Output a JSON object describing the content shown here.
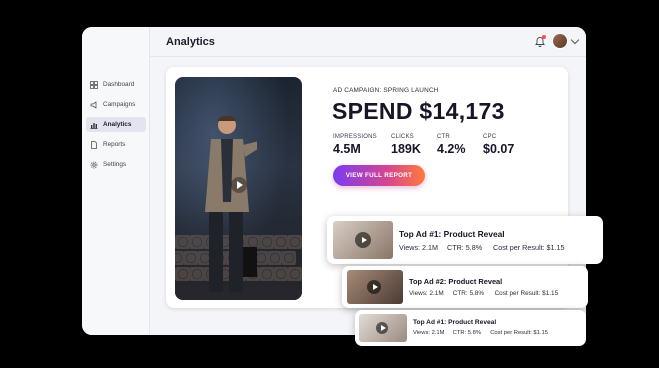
{
  "app": {
    "title": "Analytics"
  },
  "sidebar": {
    "items": [
      {
        "label": "Dashboard",
        "icon": "grid-icon"
      },
      {
        "label": "Campaigns",
        "icon": "megaphone-icon"
      },
      {
        "label": "Analytics",
        "icon": "chart-icon",
        "active": true
      },
      {
        "label": "Reports",
        "icon": "document-icon"
      },
      {
        "label": "Settings",
        "icon": "gear-icon"
      }
    ]
  },
  "campaign": {
    "label": "AD CAMPAIGN: SPRING LAUNCH",
    "spend": "SPEND $14,173",
    "metrics": [
      {
        "label": "IMPRESSIONS",
        "value": "4.5M"
      },
      {
        "label": "CLICKS",
        "value": "189K"
      },
      {
        "label": "CTR",
        "value": "4.2%"
      },
      {
        "label": "CPC",
        "value": "$0.07"
      }
    ],
    "button": "VIEW FULL REPORT"
  },
  "top_ads": [
    {
      "title": "Top Ad #1: Product Reveal",
      "views": "Views: 2.1M",
      "ctr": "CTR: 5.8%",
      "cpr": "Cost per Result: $1.15"
    },
    {
      "title": "Top Ad #2: Product Reveal",
      "views": "Views: 2.1M",
      "ctr": "CTR: 5.8%",
      "cpr": "Cost per Result: $1.15"
    },
    {
      "title": "Top Ad #1: Product Reveal",
      "views": "Views: 2.1M",
      "ctr": "CTR: 5.8%",
      "cpr": "Cost per Result: $1.15"
    }
  ],
  "colors": {
    "accent_start": "#7a3cf0",
    "accent_mid": "#d5478f",
    "accent_end": "#ff7a3c",
    "notification": "#ff4d4d"
  }
}
